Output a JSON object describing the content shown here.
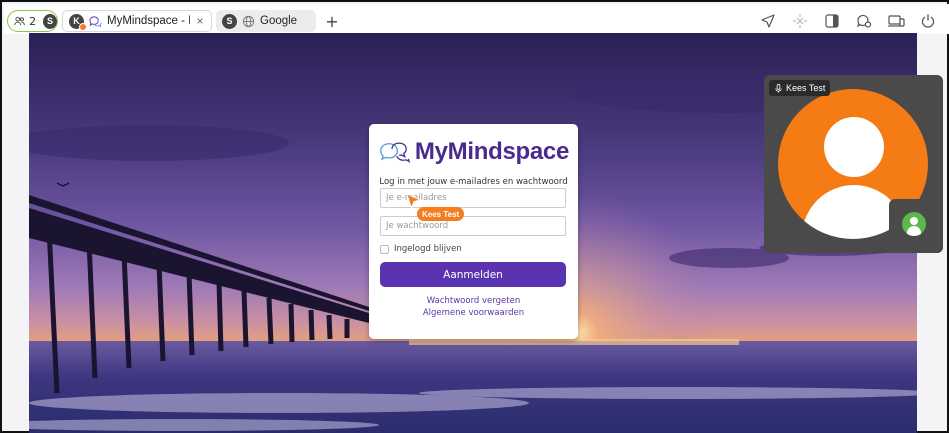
{
  "session": {
    "participant_count": "2",
    "self_initial": "S"
  },
  "tabs": [
    {
      "avatar_initial": "K",
      "title": "MyMindspace - Inl...",
      "close": "×"
    },
    {
      "avatar_initial": "S",
      "title": "Google"
    }
  ],
  "new_tab_label": "+",
  "login": {
    "brand": "MyMindspace",
    "subtitle": "Log in met jouw e-mailadres en wachtwoord",
    "email_placeholder": "Je e-mailadres",
    "password_placeholder": "Je wachtwoord",
    "remember_label": "Ingelogd blijven",
    "submit_label": "Aanmelden",
    "forgot_link": "Wachtwoord vergeten",
    "terms_link": "Algemene voorwaarden"
  },
  "remote_cursor": {
    "label": "Kees Test",
    "color": "#f57c20"
  },
  "video": {
    "participant_name": "Kees Test",
    "avatar_color": "#f57c14",
    "self_avatar_color": "#5cb84a"
  },
  "colors": {
    "brand": "#5a34b0",
    "accent_green": "#8cc44a"
  }
}
